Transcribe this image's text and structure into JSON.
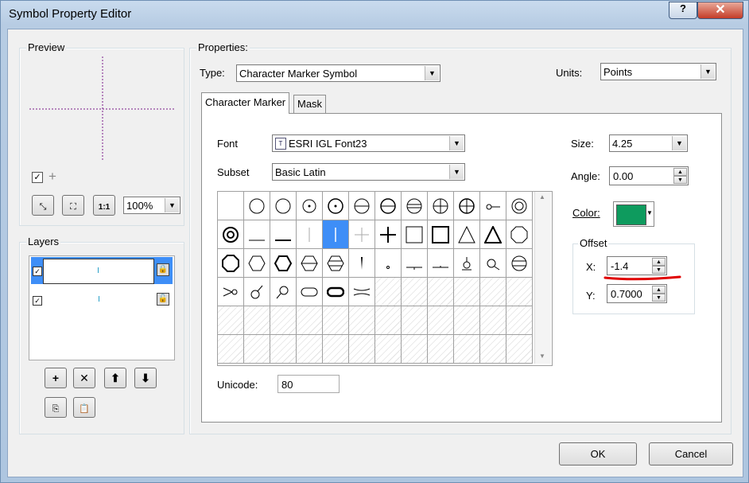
{
  "window": {
    "title": "Symbol Property Editor",
    "help_label": "?",
    "close_label": "✕"
  },
  "preview": {
    "label": "Preview",
    "zoom": "100%"
  },
  "layers": {
    "label": "Layers"
  },
  "properties": {
    "label": "Properties:",
    "type_label": "Type:",
    "type_value": "Character Marker Symbol",
    "units_label": "Units:",
    "units_value": "Points"
  },
  "tabs": [
    {
      "label": "Character Marker"
    },
    {
      "label": "Mask"
    }
  ],
  "character": {
    "font_label": "Font",
    "font_value": "ESRI IGL Font23",
    "subset_label": "Subset",
    "subset_value": "Basic Latin",
    "unicode_label": "Unicode:",
    "unicode_value": "80"
  },
  "size": {
    "label": "Size:",
    "value": "4.25"
  },
  "angle": {
    "label": "Angle:",
    "value": "0.00"
  },
  "color": {
    "label": "Color:",
    "value": "#0e9b5e"
  },
  "offset": {
    "label": "Offset",
    "x_label": "X:",
    "x_value": "-1.4",
    "y_label": "Y:",
    "y_value": "0.7000"
  },
  "buttons": {
    "ok": "OK",
    "cancel": "Cancel"
  }
}
